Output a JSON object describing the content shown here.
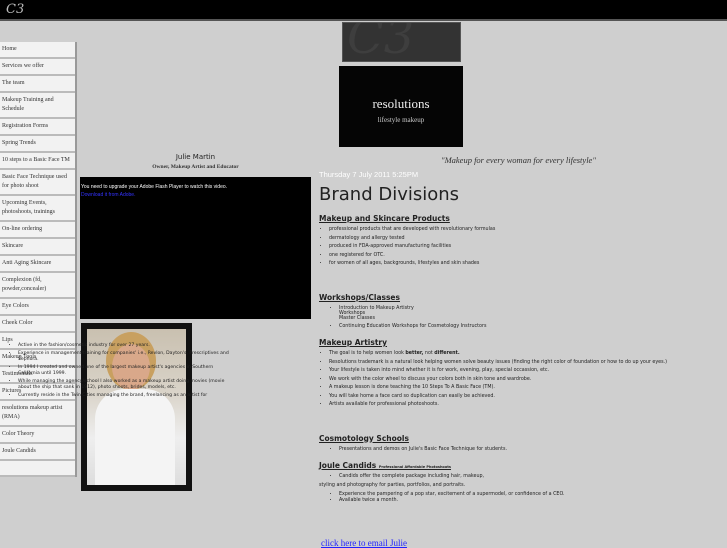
{
  "header": {
    "logo": "C3"
  },
  "sidebar": {
    "items": [
      "Home",
      "Services we offer",
      "The team",
      "Makeup Training and Schedule",
      "Registration Forms",
      "Spring Trends",
      "10 steps to a Basic Face TM",
      "Basic Face Technique used for photo shoot",
      "Upcoming Events, photoshoots, trainings",
      "On-line ordering",
      "Skincare",
      "Anti Aging Skincare",
      "Complexion (fd, powder,concealer)",
      "Eye Colors",
      "Cheek Color",
      "Lips",
      "Makeup Tools",
      "Testimonials",
      "Pictures",
      "resolutions makeup artist (RMA)",
      "Color Theory",
      "Joule Candids"
    ]
  },
  "profile": {
    "name": "Julie Martin",
    "role": "Owner, Makeup Artist and Educator",
    "flash_msg": "You need to upgrade your Adobe Flash Player to watch this video.",
    "flash_link": "Download it from Adobe.",
    "bio": [
      "Active in the fashion/cosmetic industry for over 27 years.",
      "Experience in management/training for companies' i.e., Revlon, Dayton's, Prescriptives and Sephora.",
      "In 1994 I created and owned one of the largest makeup artist's agencies in Southern California until 1999.",
      "While managing the agency/school I also worked as a makeup artist doing movies (movie about the ship that sank in 1912), photo shoots, brides, models, etc.",
      "Currently reside in the Twin Cities managing the brand, freelancing as an artist for"
    ]
  },
  "brand": {
    "logo_main": "resolutions",
    "logo_sub": "lifestyle makeup",
    "banner": "C3",
    "tagline": "\"Makeup for every woman for every lifestyle\""
  },
  "main": {
    "date": "Thursday 7 July 2011 5:25PM",
    "title": "Brand Divisions",
    "s1": {
      "h": "Makeup and Skincare Products",
      "items": [
        "professional products that are developed with revolutionary formulas",
        "dermatology and allergy tested",
        "produced in FDA-approved manufacturing facilities",
        "one registered for OTC.",
        "for women of all ages, backgrounds, lifestyles and skin shades"
      ]
    },
    "s2": {
      "h": "Workshops/Classes",
      "i1": "Introduction to Makeup Artistry",
      "i1b": "Workshops",
      "i1c": "Master Classes",
      "i2": "Continuing Education Workshops for Cosmetology Instructors"
    },
    "s3": {
      "h": "Makeup Artistry",
      "goal_a": "The goal is to help women look ",
      "goal_b": "better,",
      "goal_c": " not ",
      "goal_d": "different.",
      "items": [
        "Resolutions trademark is a natural look helping women solve beauty issues (finding the right color of foundation or how to do up your eyes.)",
        "Your lifestyle is taken into mind whether it is for work, evening, play, special occassion, etc.",
        "We work with the color wheel to discuss your colors both in skin tone and wardrobe.",
        "A makeup lesson is done teaching the 10 Steps To A Basic Face (TM).",
        "You will take home a face card so duplication can easily be achieved.",
        "Artists available for professional photoshoots."
      ]
    },
    "s4": {
      "h": "Cosmotology Schools",
      "items": [
        "Presentations and demos on Julie's Basic Face Technique for students."
      ]
    },
    "s5": {
      "h": "Joule Candids ",
      "sub": "Professional Affordable Photoshoots",
      "i1": "Candids offer the complete package including hair, makeup,",
      "p": "styling and photography for parties, portfolios, and portraits.",
      "items": [
        "Experience the pampering of a pop star, excitement of a supermodel, or confidence of a CEO.",
        "Available twice a month."
      ]
    },
    "email": "click here to email Julie"
  }
}
